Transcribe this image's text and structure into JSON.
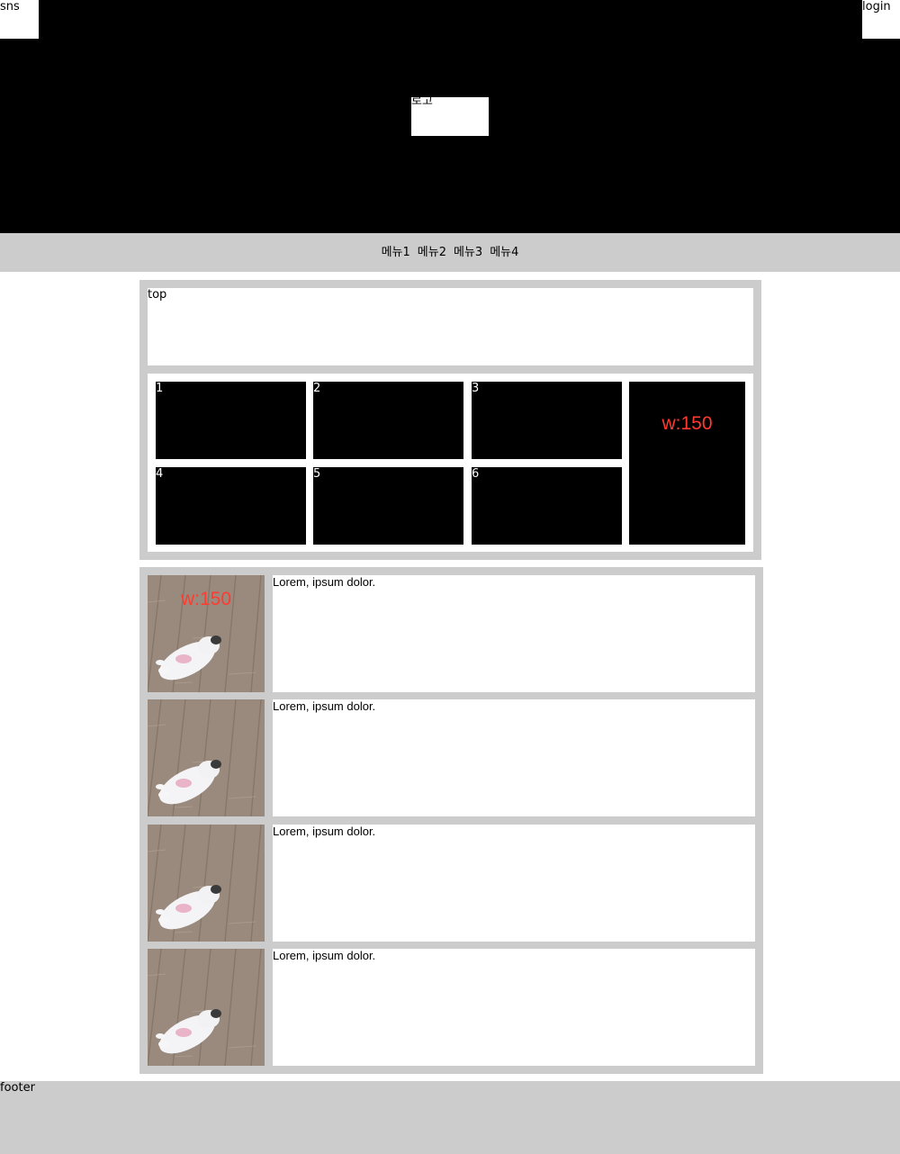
{
  "header": {
    "sns_label": "sns",
    "login_label": "login",
    "logo_label": "로고"
  },
  "nav": {
    "items": [
      "메뉴1",
      "메뉴2",
      "메뉴3",
      "메뉴4"
    ]
  },
  "section1": {
    "top_label": "top",
    "tiles": [
      "1",
      "2",
      "3",
      "4",
      "5",
      "6"
    ],
    "side_label": "w:150"
  },
  "section2": {
    "overlay_label": "w:150",
    "rows": [
      {
        "text": "Lorem, ipsum dolor."
      },
      {
        "text": "Lorem, ipsum dolor."
      },
      {
        "text": "Lorem, ipsum dolor."
      },
      {
        "text": "Lorem, ipsum dolor."
      }
    ]
  },
  "footer": {
    "label": "footer"
  },
  "colors": {
    "header_bg": "#000000",
    "gray": "#cccccc",
    "accent_red": "#ff3b30"
  }
}
